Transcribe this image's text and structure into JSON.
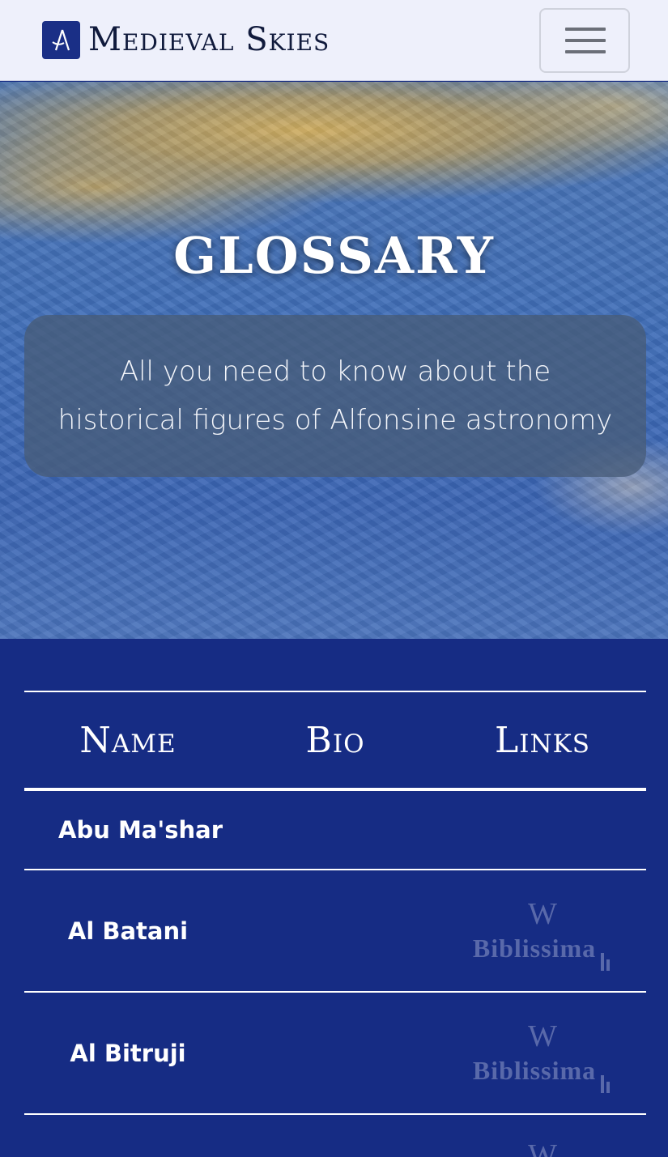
{
  "navbar": {
    "brand_name": "Medieval Skies",
    "logo_icon": "astrolabe-logo-icon",
    "menu_icon": "hamburger-menu-icon"
  },
  "hero": {
    "title": "GLOSSARY",
    "subtitle": "All you need to know about the historical figures of Alfonsine astronomy"
  },
  "table": {
    "headers": [
      "Name",
      "Bio",
      "Links"
    ],
    "rows": [
      {
        "name": "Abu Ma'shar",
        "links": []
      },
      {
        "name": "Al Batani",
        "links": [
          "W",
          "Biblissima"
        ]
      },
      {
        "name": "Al Bitruji",
        "links": [
          "W",
          "Biblissima"
        ]
      },
      {
        "name": "",
        "links": [
          "W"
        ]
      }
    ]
  },
  "colors": {
    "navbar_bg": "#eef0fb",
    "page_bg": "#162c84",
    "brand_blue": "#1a2f86"
  }
}
